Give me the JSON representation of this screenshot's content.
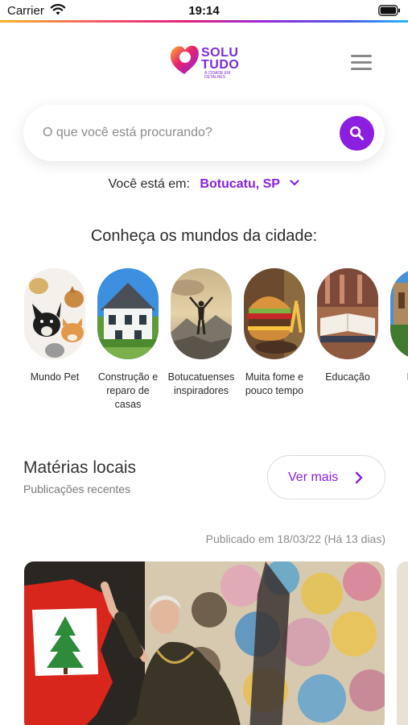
{
  "status_bar": {
    "carrier": "Carrier",
    "time": "19:14"
  },
  "header": {
    "logo_line1": "SOLU",
    "logo_line2": "TUDO",
    "logo_tagline": "A CIDADE EM DETALHES"
  },
  "search": {
    "placeholder": "O que você está procurando?"
  },
  "location": {
    "label": "Você está em:",
    "city": "Botucatu, SP"
  },
  "worlds": {
    "title": "Conheça os mundos da cidade:",
    "items": [
      {
        "label": "Mundo Pet",
        "icon": "pets-photo"
      },
      {
        "label": "Construção e reparo de casas",
        "icon": "house-photo"
      },
      {
        "label": "Botucatuenses inspiradores",
        "icon": "mountain-person-photo"
      },
      {
        "label": "Muita fome e pouco tempo",
        "icon": "burger-photo"
      },
      {
        "label": "Educação",
        "icon": "book-photo"
      },
      {
        "label": "No Ba",
        "icon": "building-photo"
      }
    ]
  },
  "materias": {
    "title": "Matérias locais",
    "subtitle": "Publicações recentes",
    "ver_mais": "Ver mais"
  },
  "article": {
    "published": "Publicado em 18/03/22 (Há 13 dias)"
  },
  "colors": {
    "accent": "#8a1fe0",
    "text": "#2b2b2b",
    "muted": "#8c8c8c"
  }
}
